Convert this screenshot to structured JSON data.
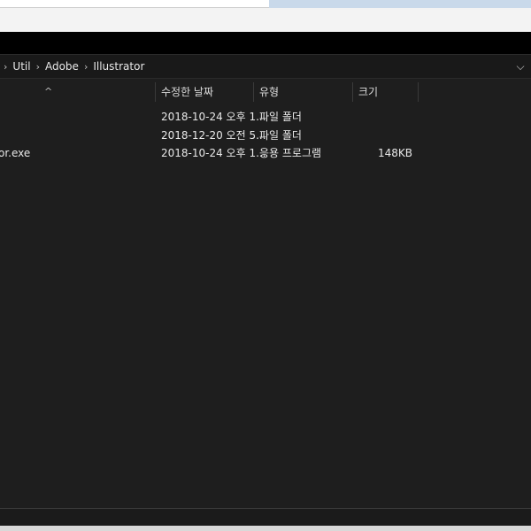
{
  "breadcrumb": {
    "items": [
      "Util",
      "Adobe",
      "Illustrator"
    ]
  },
  "icons": {
    "separator": "chevron-right-icon",
    "dropdown": "chevron-down-icon",
    "sort": "sort-ascending-icon"
  },
  "glyphs": {
    "separator": "›",
    "dropdown": "⌵",
    "sort": "^"
  },
  "columns": {
    "date": "수정한 날짜",
    "type": "유형",
    "size": "크기"
  },
  "files": [
    {
      "name": "",
      "date": "2018-10-24 오후 1...",
      "type": "파일 폴더",
      "size": ""
    },
    {
      "name": "",
      "date": "2018-12-20 오전 5...",
      "type": "파일 폴더",
      "size": ""
    },
    {
      "name": "or.exe",
      "date": "2018-10-24 오후 1...",
      "type": "응용 프로그램",
      "size": "148KB"
    }
  ],
  "colors": {
    "background": "#1e1e1e",
    "title_bar": "#000000",
    "accent_strip": "#c9d9ea"
  }
}
